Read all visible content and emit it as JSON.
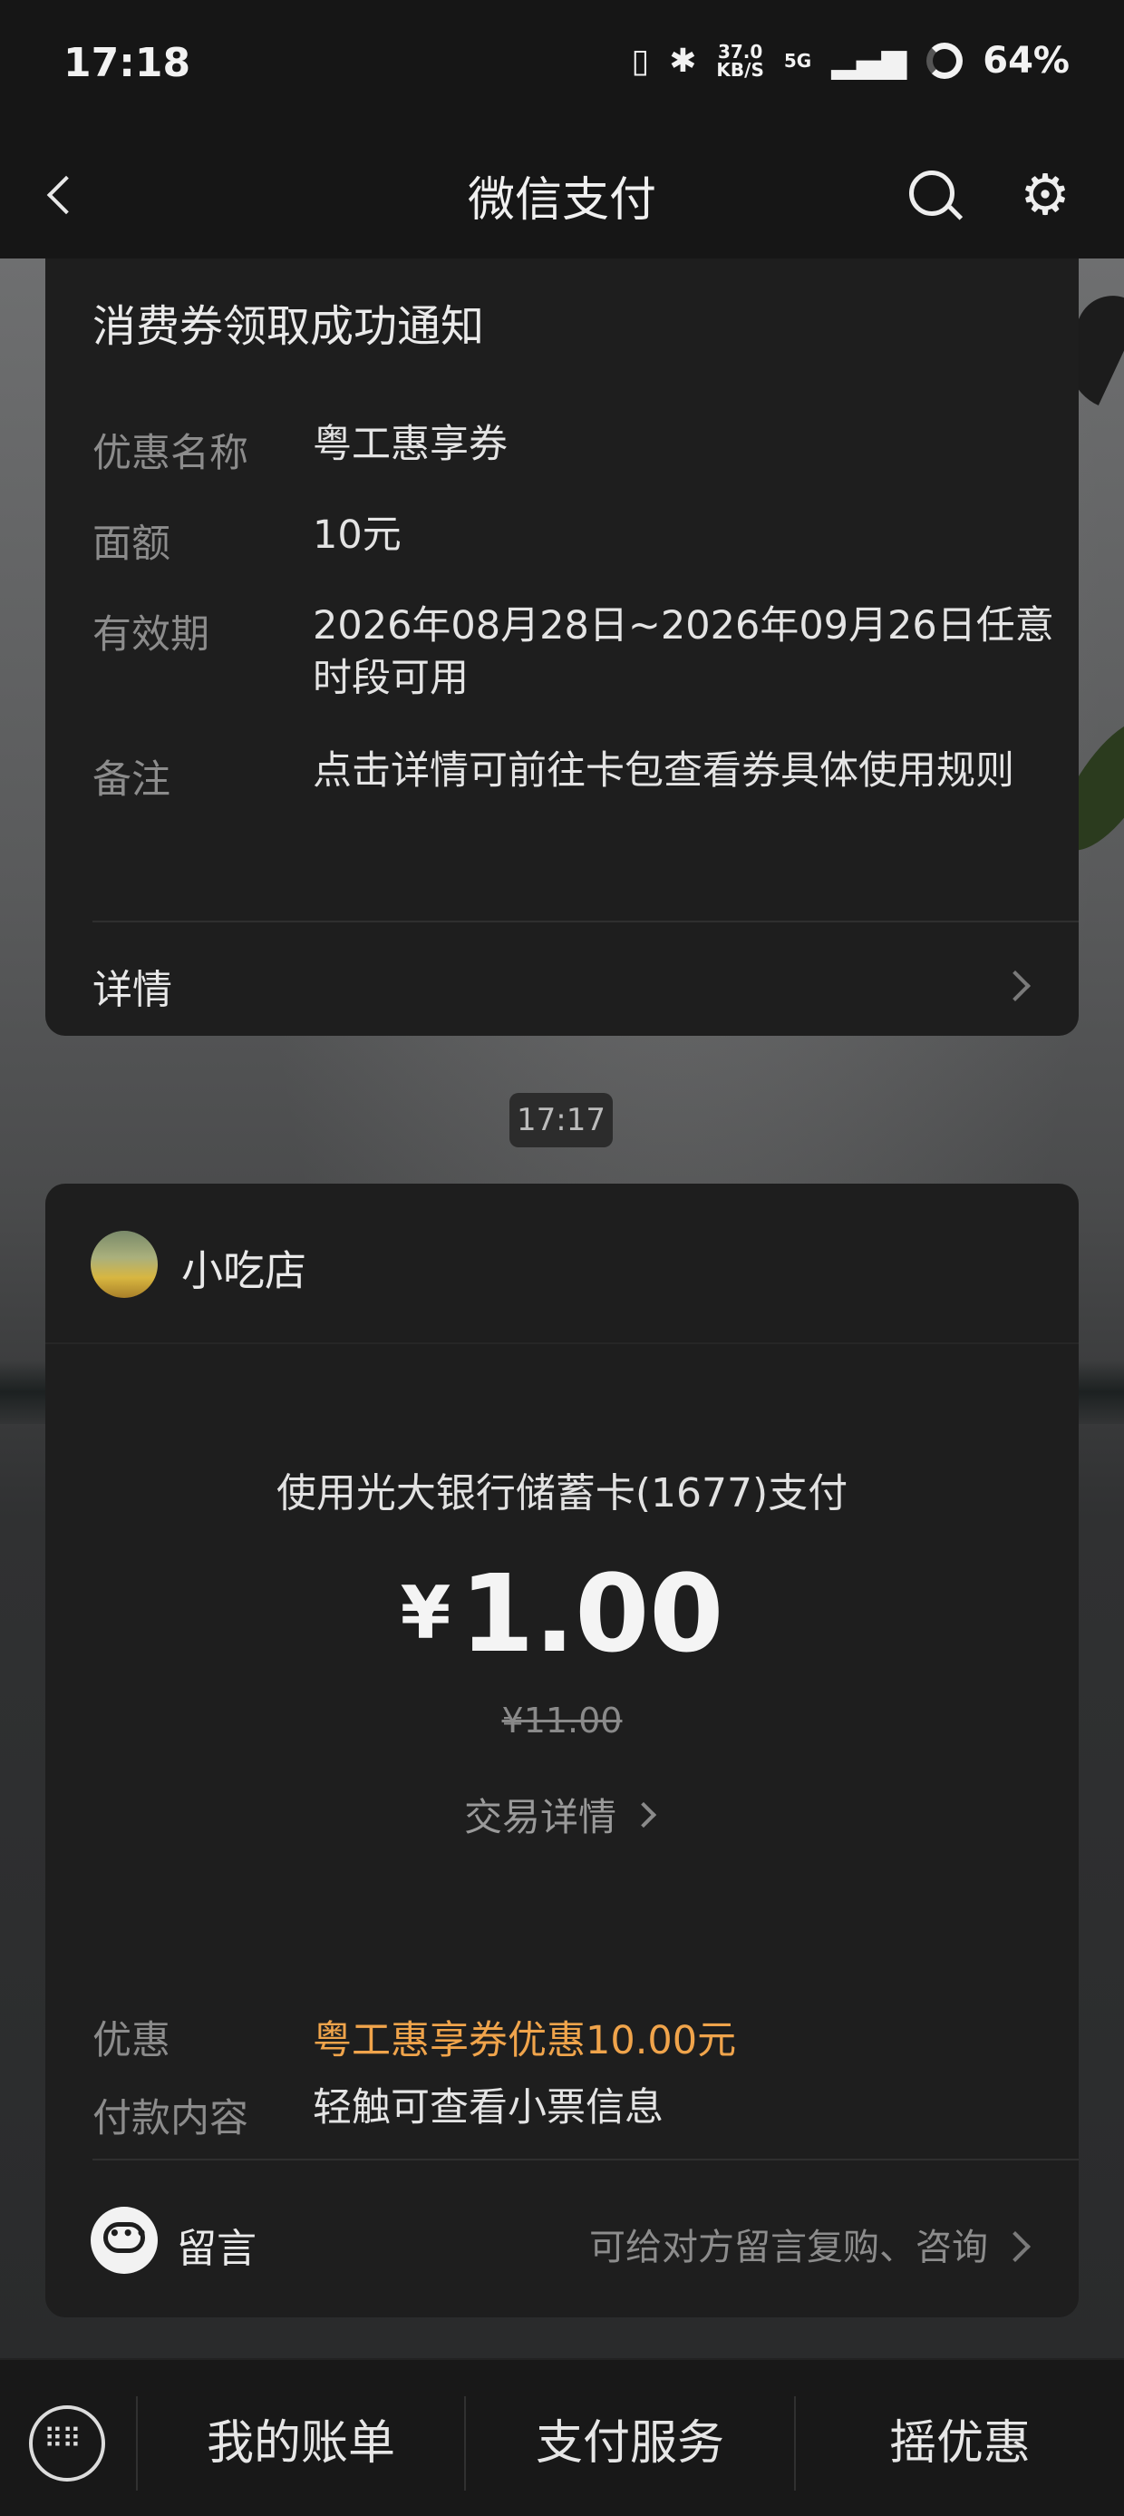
{
  "status_bar": {
    "time": "17:18",
    "net_speed_value": "37.0",
    "net_speed_unit": "KB/S",
    "network": "5G",
    "battery": "64%"
  },
  "nav": {
    "title": "微信支付",
    "back_icon": "chevron-left-icon",
    "search_icon": "search-icon",
    "settings_icon": "gear-icon"
  },
  "coupon_card": {
    "title": "消费券领取成功通知",
    "fields": [
      {
        "label": "优惠名称",
        "value": "粤工惠享券"
      },
      {
        "label": "面额",
        "value": "10元"
      },
      {
        "label": "有效期",
        "value": "2026年08月28日~2026年09月26日任意时段可用"
      },
      {
        "label": "备注",
        "value": "点击详情可前往卡包查看券具体使用规则"
      }
    ],
    "detail_link": "详情"
  },
  "timestamp": "17:17",
  "payment_card": {
    "merchant": "小吃店",
    "pay_method": "使用光大银行储蓄卡(1677)支付",
    "currency_symbol": "¥",
    "amount": "1.00",
    "original_amount": "¥11.00",
    "transaction_detail": "交易详情",
    "discount_label": "优惠",
    "discount_value": "粤工惠享券优惠10.00元",
    "content_label": "付款内容",
    "content_value": "轻触可查看小票信息",
    "message_label": "留言",
    "message_hint": "可给对方留言复购、咨询"
  },
  "bottom_bar": {
    "tabs": [
      "我的账单",
      "支付服务",
      "摇优惠"
    ]
  },
  "colors": {
    "accent": "#f0a44b",
    "card_bg": "#1e1e1e",
    "bar_bg": "#161616"
  }
}
